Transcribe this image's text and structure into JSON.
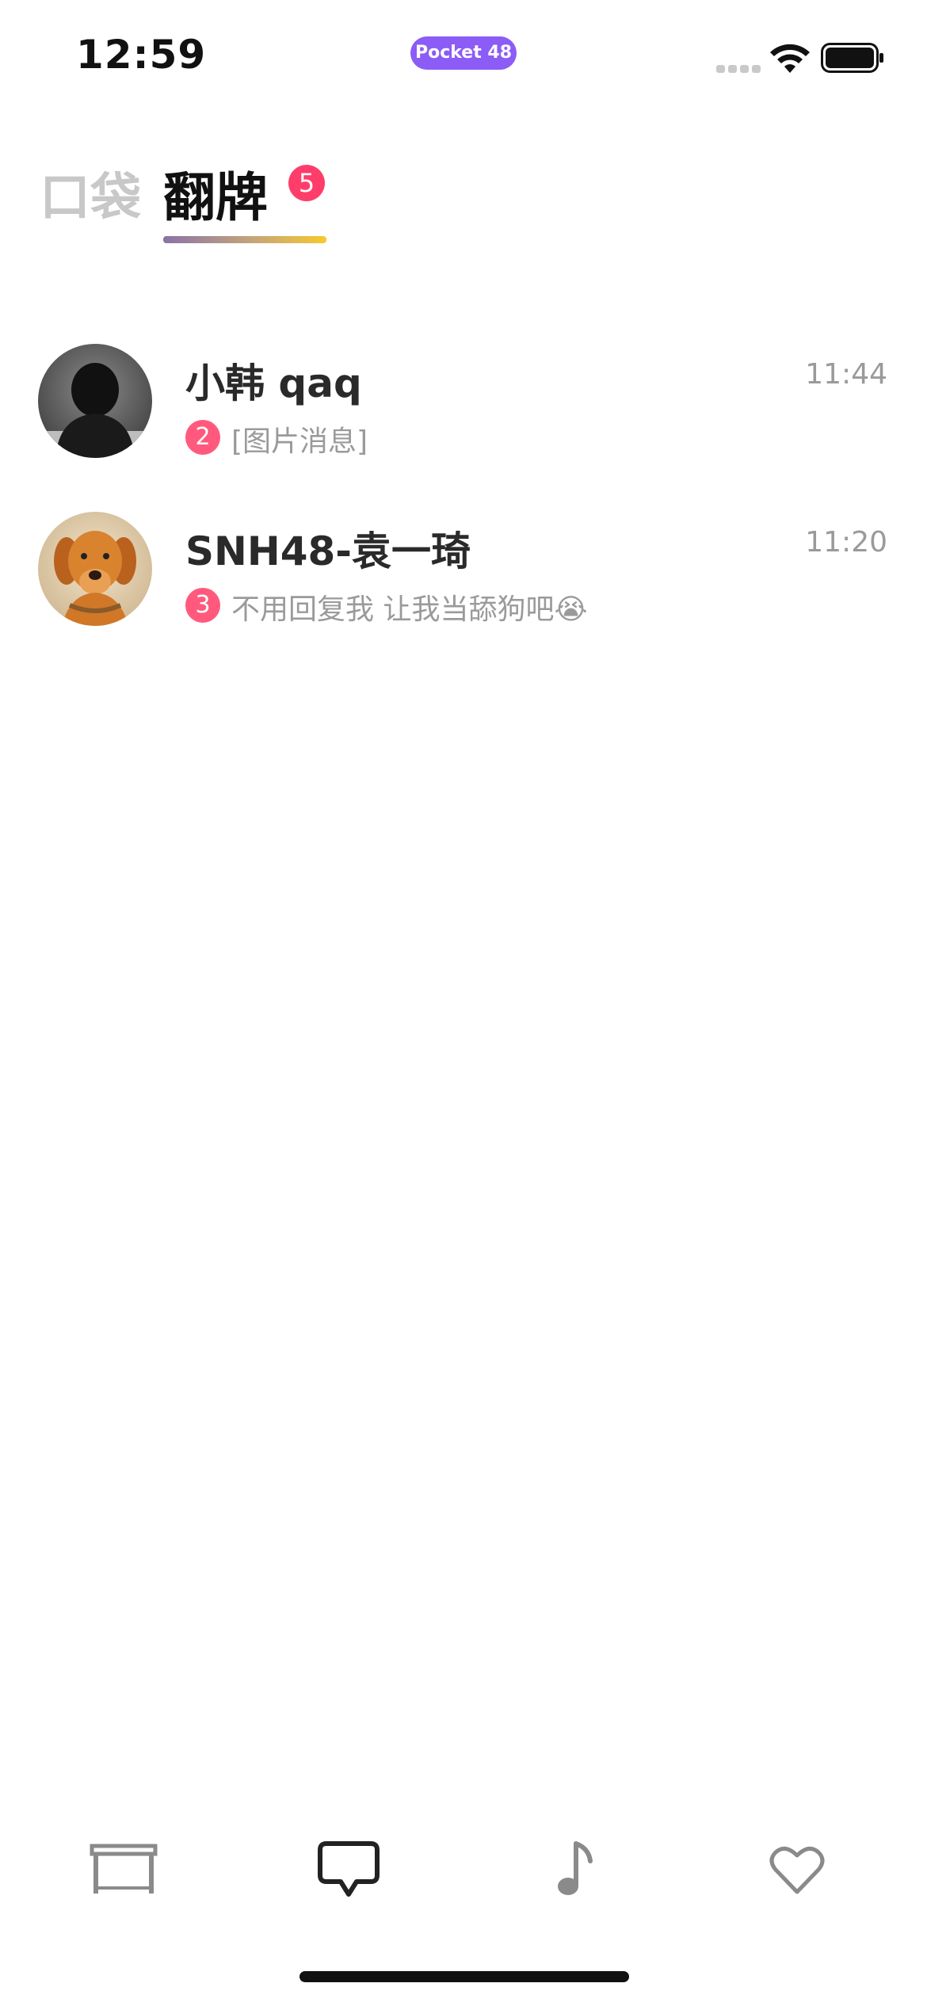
{
  "status_bar": {
    "time": "12:59",
    "app_pill": "Pocket 48"
  },
  "tabs": {
    "pocket_label": "口袋",
    "fanpai_label": "翻牌",
    "fanpai_badge": "5",
    "active": "翻牌"
  },
  "conversations": [
    {
      "name": "小韩 qaq",
      "time": "11:44",
      "unread": "2",
      "preview": "[图片消息]"
    },
    {
      "name": "SNH48-袁一琦",
      "time": "11:20",
      "unread": "3",
      "preview": "不用回复我 让我当舔狗吧😭"
    }
  ],
  "bottom_nav": {
    "items": [
      {
        "icon": "table-icon",
        "active": false
      },
      {
        "icon": "chat-bubble-icon",
        "active": true
      },
      {
        "icon": "music-note-icon",
        "active": false
      },
      {
        "icon": "heart-icon",
        "active": false
      }
    ]
  },
  "colors": {
    "badge": "#ff3d6a",
    "unread": "#ff5a7d",
    "pill": "#8b5cf6",
    "underline_start": "#8a72a8",
    "underline_end": "#f6c92e"
  }
}
